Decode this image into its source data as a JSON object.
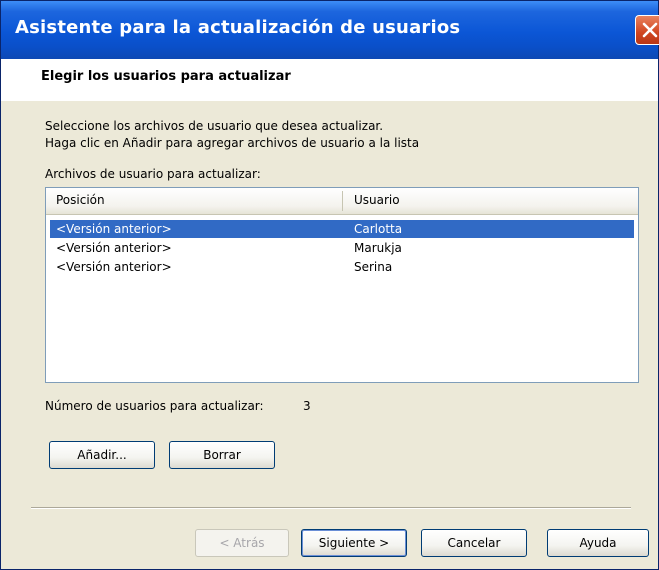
{
  "window": {
    "title": "Asistente para la actualización de usuarios"
  },
  "header": {
    "title": "Elegir los usuarios para actualizar"
  },
  "instructions": {
    "line1": "Seleccione los archivos de usuario que desea actualizar.",
    "line2": "Haga clic en Añadir para agregar archivos de usuario a la lista"
  },
  "list": {
    "label": "Archivos de usuario para actualizar:",
    "columns": {
      "position": "Posición",
      "user": "Usuario"
    },
    "rows": [
      {
        "position": "<Versión anterior>",
        "user": "Carlotta",
        "selected": true
      },
      {
        "position": "<Versión anterior>",
        "user": "Marukja",
        "selected": false
      },
      {
        "position": "<Versión anterior>",
        "user": "Serina",
        "selected": false
      }
    ]
  },
  "count": {
    "label": "Número de usuarios para actualizar:",
    "value": "3"
  },
  "buttons": {
    "add": "Añadir...",
    "delete": "Borrar",
    "back": "< Atrás",
    "next": "Siguiente >",
    "cancel": "Cancelar",
    "help": "Ayuda"
  },
  "colors": {
    "selection": "#316ac5",
    "titlebar": "#0b56d6",
    "close": "#d04520"
  },
  "icons": {
    "close": "close-icon"
  }
}
